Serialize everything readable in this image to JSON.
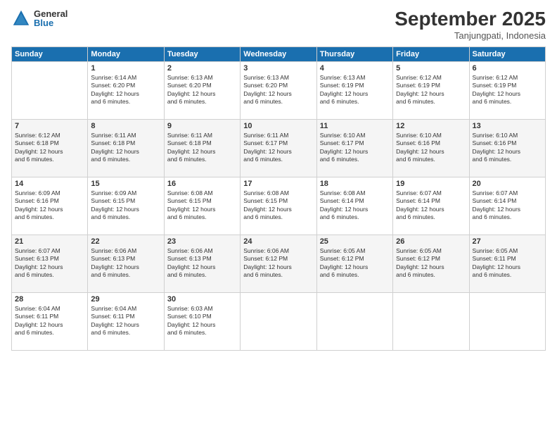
{
  "logo": {
    "general": "General",
    "blue": "Blue"
  },
  "title": "September 2025",
  "location": "Tanjungpati, Indonesia",
  "days_of_week": [
    "Sunday",
    "Monday",
    "Tuesday",
    "Wednesday",
    "Thursday",
    "Friday",
    "Saturday"
  ],
  "weeks": [
    [
      {
        "day": "",
        "info": ""
      },
      {
        "day": "1",
        "info": "Sunrise: 6:14 AM\nSunset: 6:20 PM\nDaylight: 12 hours\nand 6 minutes."
      },
      {
        "day": "2",
        "info": "Sunrise: 6:13 AM\nSunset: 6:20 PM\nDaylight: 12 hours\nand 6 minutes."
      },
      {
        "day": "3",
        "info": "Sunrise: 6:13 AM\nSunset: 6:20 PM\nDaylight: 12 hours\nand 6 minutes."
      },
      {
        "day": "4",
        "info": "Sunrise: 6:13 AM\nSunset: 6:19 PM\nDaylight: 12 hours\nand 6 minutes."
      },
      {
        "day": "5",
        "info": "Sunrise: 6:12 AM\nSunset: 6:19 PM\nDaylight: 12 hours\nand 6 minutes."
      },
      {
        "day": "6",
        "info": "Sunrise: 6:12 AM\nSunset: 6:19 PM\nDaylight: 12 hours\nand 6 minutes."
      }
    ],
    [
      {
        "day": "7",
        "info": "Sunrise: 6:12 AM\nSunset: 6:18 PM\nDaylight: 12 hours\nand 6 minutes."
      },
      {
        "day": "8",
        "info": "Sunrise: 6:11 AM\nSunset: 6:18 PM\nDaylight: 12 hours\nand 6 minutes."
      },
      {
        "day": "9",
        "info": "Sunrise: 6:11 AM\nSunset: 6:18 PM\nDaylight: 12 hours\nand 6 minutes."
      },
      {
        "day": "10",
        "info": "Sunrise: 6:11 AM\nSunset: 6:17 PM\nDaylight: 12 hours\nand 6 minutes."
      },
      {
        "day": "11",
        "info": "Sunrise: 6:10 AM\nSunset: 6:17 PM\nDaylight: 12 hours\nand 6 minutes."
      },
      {
        "day": "12",
        "info": "Sunrise: 6:10 AM\nSunset: 6:16 PM\nDaylight: 12 hours\nand 6 minutes."
      },
      {
        "day": "13",
        "info": "Sunrise: 6:10 AM\nSunset: 6:16 PM\nDaylight: 12 hours\nand 6 minutes."
      }
    ],
    [
      {
        "day": "14",
        "info": "Sunrise: 6:09 AM\nSunset: 6:16 PM\nDaylight: 12 hours\nand 6 minutes."
      },
      {
        "day": "15",
        "info": "Sunrise: 6:09 AM\nSunset: 6:15 PM\nDaylight: 12 hours\nand 6 minutes."
      },
      {
        "day": "16",
        "info": "Sunrise: 6:08 AM\nSunset: 6:15 PM\nDaylight: 12 hours\nand 6 minutes."
      },
      {
        "day": "17",
        "info": "Sunrise: 6:08 AM\nSunset: 6:15 PM\nDaylight: 12 hours\nand 6 minutes."
      },
      {
        "day": "18",
        "info": "Sunrise: 6:08 AM\nSunset: 6:14 PM\nDaylight: 12 hours\nand 6 minutes."
      },
      {
        "day": "19",
        "info": "Sunrise: 6:07 AM\nSunset: 6:14 PM\nDaylight: 12 hours\nand 6 minutes."
      },
      {
        "day": "20",
        "info": "Sunrise: 6:07 AM\nSunset: 6:14 PM\nDaylight: 12 hours\nand 6 minutes."
      }
    ],
    [
      {
        "day": "21",
        "info": "Sunrise: 6:07 AM\nSunset: 6:13 PM\nDaylight: 12 hours\nand 6 minutes."
      },
      {
        "day": "22",
        "info": "Sunrise: 6:06 AM\nSunset: 6:13 PM\nDaylight: 12 hours\nand 6 minutes."
      },
      {
        "day": "23",
        "info": "Sunrise: 6:06 AM\nSunset: 6:13 PM\nDaylight: 12 hours\nand 6 minutes."
      },
      {
        "day": "24",
        "info": "Sunrise: 6:06 AM\nSunset: 6:12 PM\nDaylight: 12 hours\nand 6 minutes."
      },
      {
        "day": "25",
        "info": "Sunrise: 6:05 AM\nSunset: 6:12 PM\nDaylight: 12 hours\nand 6 minutes."
      },
      {
        "day": "26",
        "info": "Sunrise: 6:05 AM\nSunset: 6:12 PM\nDaylight: 12 hours\nand 6 minutes."
      },
      {
        "day": "27",
        "info": "Sunrise: 6:05 AM\nSunset: 6:11 PM\nDaylight: 12 hours\nand 6 minutes."
      }
    ],
    [
      {
        "day": "28",
        "info": "Sunrise: 6:04 AM\nSunset: 6:11 PM\nDaylight: 12 hours\nand 6 minutes."
      },
      {
        "day": "29",
        "info": "Sunrise: 6:04 AM\nSunset: 6:11 PM\nDaylight: 12 hours\nand 6 minutes."
      },
      {
        "day": "30",
        "info": "Sunrise: 6:03 AM\nSunset: 6:10 PM\nDaylight: 12 hours\nand 6 minutes."
      },
      {
        "day": "",
        "info": ""
      },
      {
        "day": "",
        "info": ""
      },
      {
        "day": "",
        "info": ""
      },
      {
        "day": "",
        "info": ""
      }
    ]
  ]
}
